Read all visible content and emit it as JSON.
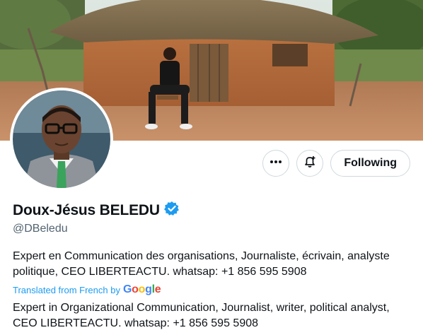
{
  "profile": {
    "display_name": "Doux-Jésus BELEDU",
    "handle": "@DBeledu",
    "verified": true,
    "bio_original": "Expert en Communication des organisations, Journaliste, écrivain, analyste politique, CEO LIBERTEACTU. whatsap: +1 856 595 5908",
    "translated_label": "Translated from French by",
    "translator_logo": "Google",
    "bio_translated": "Expert in Organizational Communication, Journalist, writer, political analyst, CEO LIBERTEACTU. whatsap: +1 856 595 5908"
  },
  "actions": {
    "more_icon": "more-horizontal-icon",
    "notify_icon": "bell-plus-icon",
    "follow_label": "Following"
  },
  "colors": {
    "verified_blue": "#1d9bf0",
    "link_blue": "#1d9bf0",
    "secondary_text": "#536471",
    "border": "#cfd9de"
  }
}
